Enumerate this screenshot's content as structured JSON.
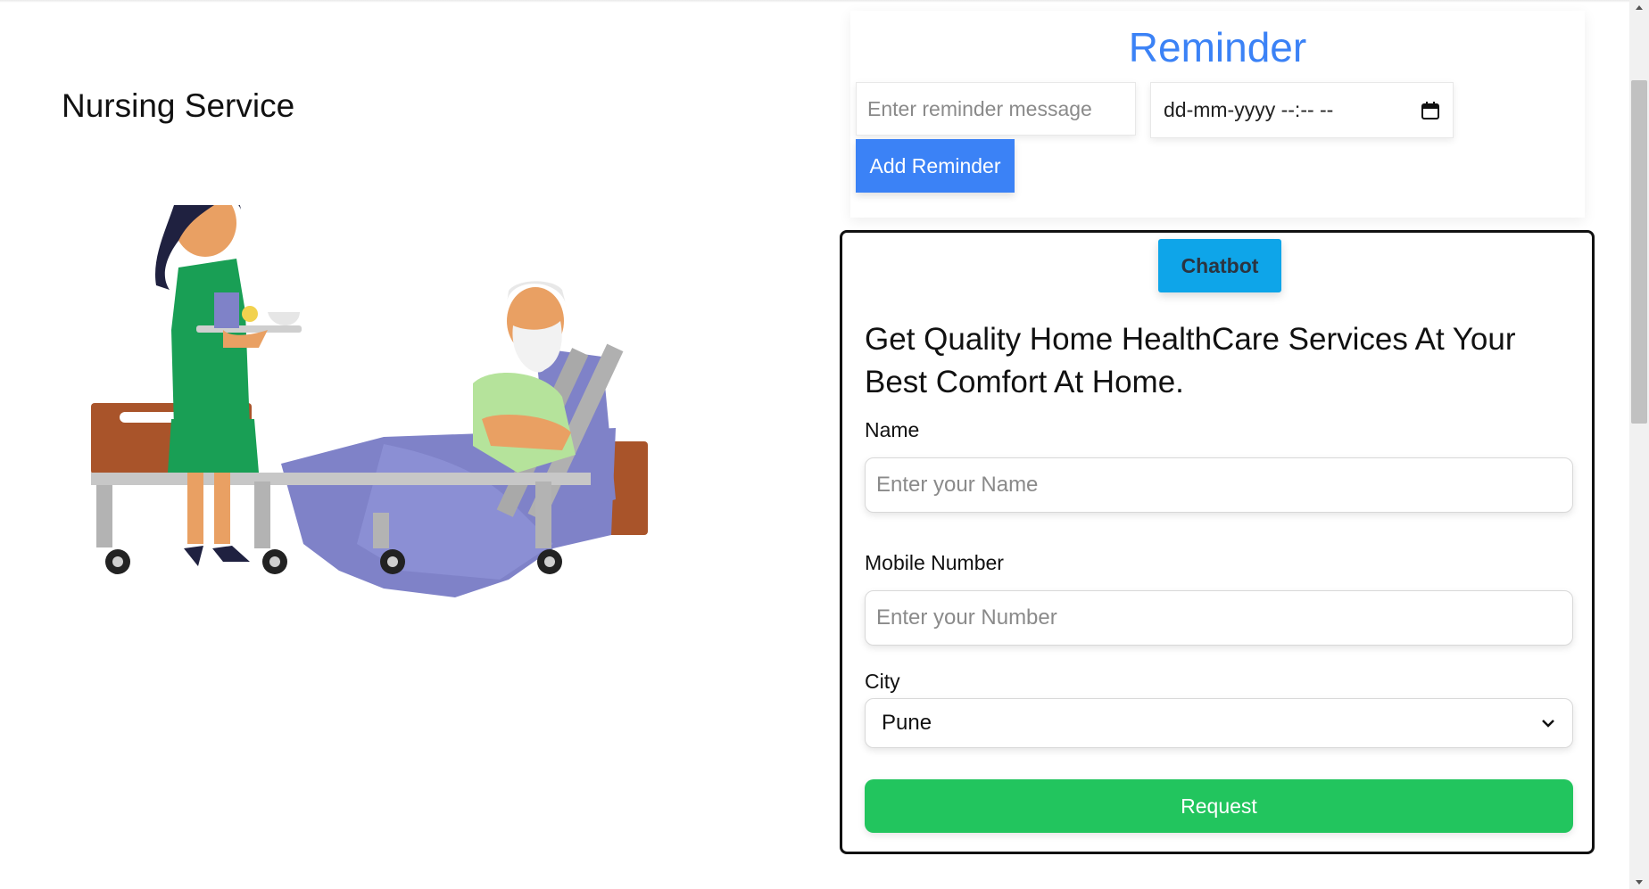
{
  "left": {
    "service_title": "Nursing Service",
    "illustration_icon": "nurse-patient-bed-illustration"
  },
  "reminder": {
    "title": "Reminder",
    "message_placeholder": "Enter reminder message",
    "datetime_placeholder": "dd-mm-yyyy --:-- --",
    "add_button": "Add Reminder",
    "accent_color": "#3b82f6"
  },
  "form": {
    "chatbot_button": "Chatbot",
    "heading": "Get Quality Home HealthCare Services At Your Best Comfort At Home.",
    "name_label": "Name",
    "name_placeholder": "Enter your Name",
    "mobile_label": "Mobile Number",
    "mobile_placeholder": "Enter your Number",
    "city_label": "City",
    "city_value": "Pune",
    "request_button": "Request",
    "request_color": "#22c55e",
    "chatbot_color": "#0ea5e9"
  }
}
